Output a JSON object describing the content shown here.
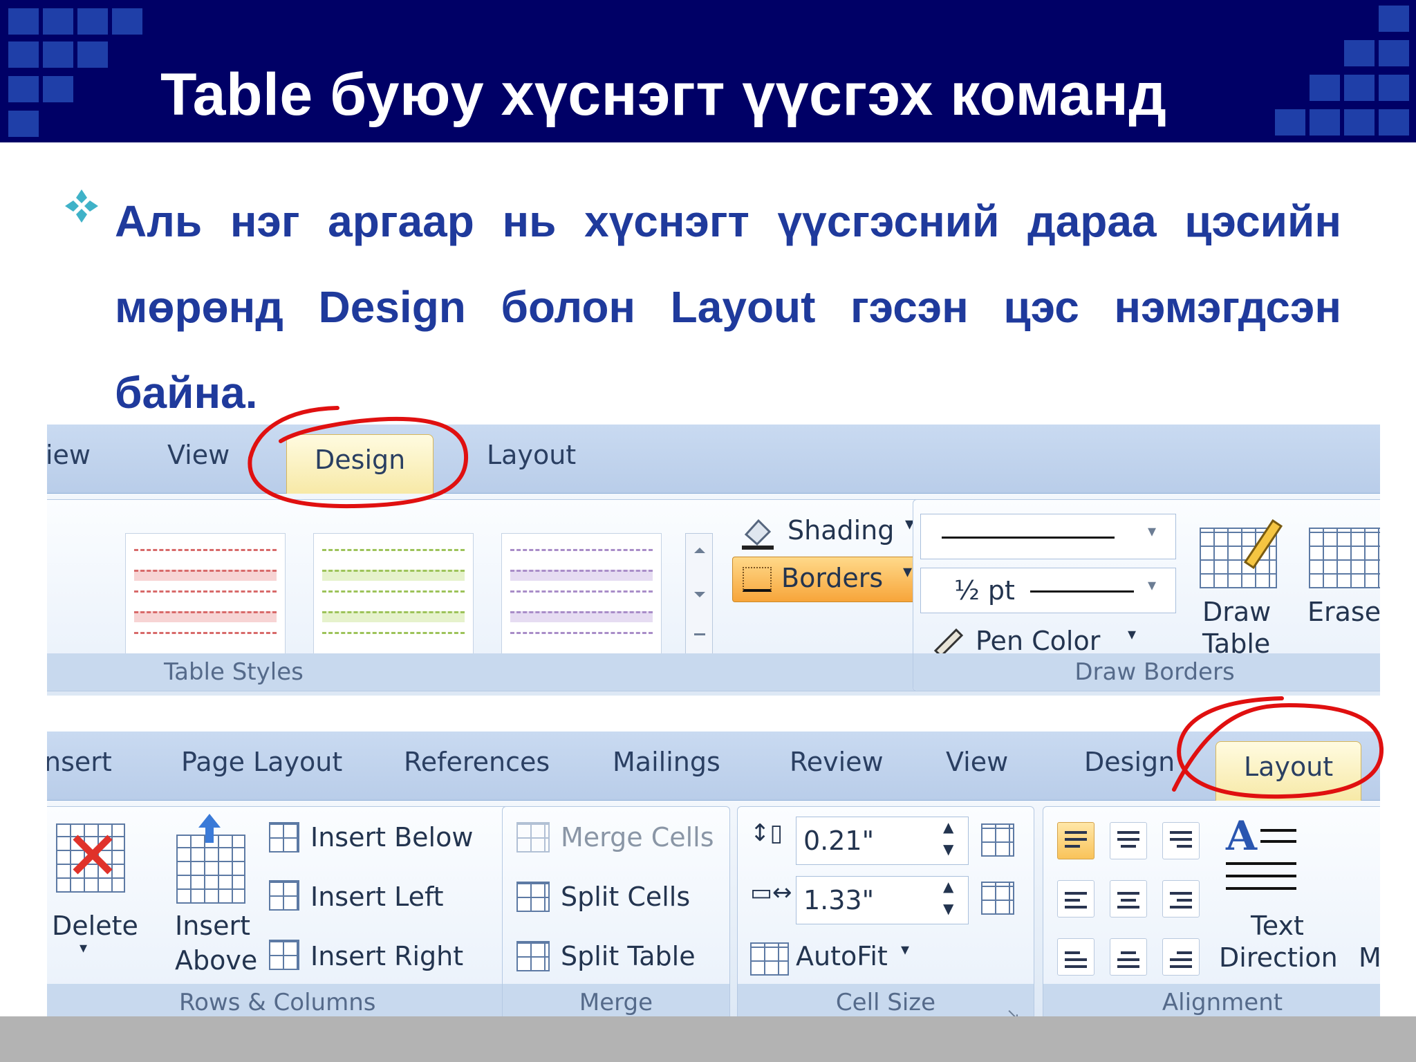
{
  "slide": {
    "title": "Table буюу хүснэгт үүсгэх команд",
    "bullet": "Аль нэг аргаар нь хүснэгт үүсгэсний дараа цэсийн мөрөнд Design болон Layout гэсэн цэс нэмэгдсэн байна."
  },
  "colors": {
    "banner": "#000066",
    "title_text": "#ffffff",
    "bullet_text": "#1f3a9c",
    "highlight_circle": "#e01010"
  },
  "ribbon_design": {
    "tabs": [
      "iew",
      "View",
      "Design",
      "Layout"
    ],
    "active_tab": "Design",
    "table_styles_label": "Table Styles",
    "shading": "Shading",
    "borders": "Borders",
    "pen_weight": "½ pt",
    "pen_color": "Pen Color",
    "draw_table": [
      "Draw",
      "Table"
    ],
    "eraser": "Eraser",
    "draw_borders_label": "Draw Borders"
  },
  "ribbon_layout": {
    "tabs": [
      "nsert",
      "Page Layout",
      "References",
      "Mailings",
      "Review",
      "View",
      "Design",
      "Layout"
    ],
    "active_tab": "Layout",
    "delete": "Delete",
    "insert_above": [
      "Insert",
      "Above"
    ],
    "insert_below": "Insert Below",
    "insert_left": "Insert Left",
    "insert_right": "Insert Right",
    "rows_columns_label": "Rows & Columns",
    "merge_cells": "Merge Cells",
    "split_cells": "Split Cells",
    "split_table": "Split Table",
    "merge_label": "Merge",
    "height": "0.21\"",
    "width": "1.33\"",
    "autofit": "AutoFit",
    "cell_size_label": "Cell Size",
    "text_direction": [
      "Text",
      "Direction"
    ],
    "margins_partial": "Ma",
    "alignment_label": "Alignment"
  }
}
